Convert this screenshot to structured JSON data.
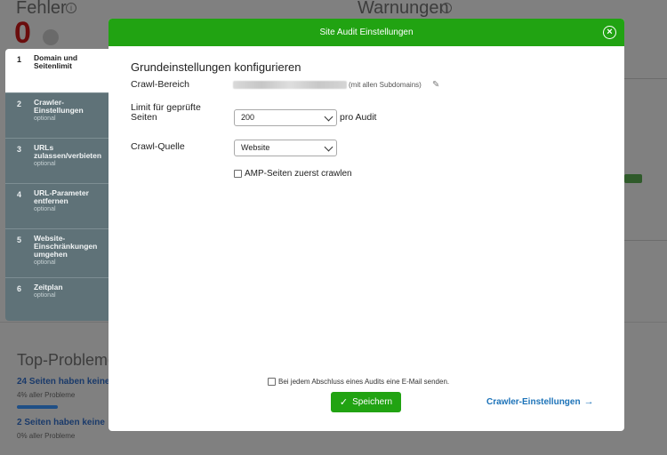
{
  "background": {
    "errors_label": "Fehler",
    "errors_count": "0",
    "warnings_label": "Warnungen",
    "top_problems": "Top-Probleme",
    "problem1": "24 Seiten haben keine",
    "problem1_sub": "4% aller Probleme",
    "problem2": "2 Seiten haben keine",
    "problem2_sub": "0% aller Probleme"
  },
  "steps": [
    {
      "num": "1",
      "title": "Domain und Seitenlimit",
      "sub": ""
    },
    {
      "num": "2",
      "title": "Crawler-Einstellungen",
      "sub": "optional"
    },
    {
      "num": "3",
      "title": "URLs zulassen/verbieten",
      "sub": "optional"
    },
    {
      "num": "4",
      "title": "URL-Parameter entfernen",
      "sub": "optional"
    },
    {
      "num": "5",
      "title": "Website-Einschränkungen umgehen",
      "sub": "optional"
    },
    {
      "num": "6",
      "title": "Zeitplan",
      "sub": "optional"
    }
  ],
  "modal": {
    "title": "Site Audit Einstellungen",
    "section_title": "Grundeinstellungen konfigurieren",
    "crawl_scope_label": "Crawl-Bereich",
    "subdomains_note": "(mit allen Subdomains)",
    "limit_label": "Limit für geprüfte Seiten",
    "limit_value": "200",
    "per_audit": "pro Audit",
    "source_label": "Crawl-Quelle",
    "source_value": "Website",
    "amp_label": "AMP-Seiten zuerst crawlen",
    "email_label": "Bei jedem Abschluss eines Audits eine E-Mail senden.",
    "save_label": "Speichern",
    "next_label": "Crawler-Einstellungen"
  },
  "colors": {
    "accent_green": "#21a312",
    "link_blue": "#1b72b8",
    "sidebar": "#5f7278"
  }
}
